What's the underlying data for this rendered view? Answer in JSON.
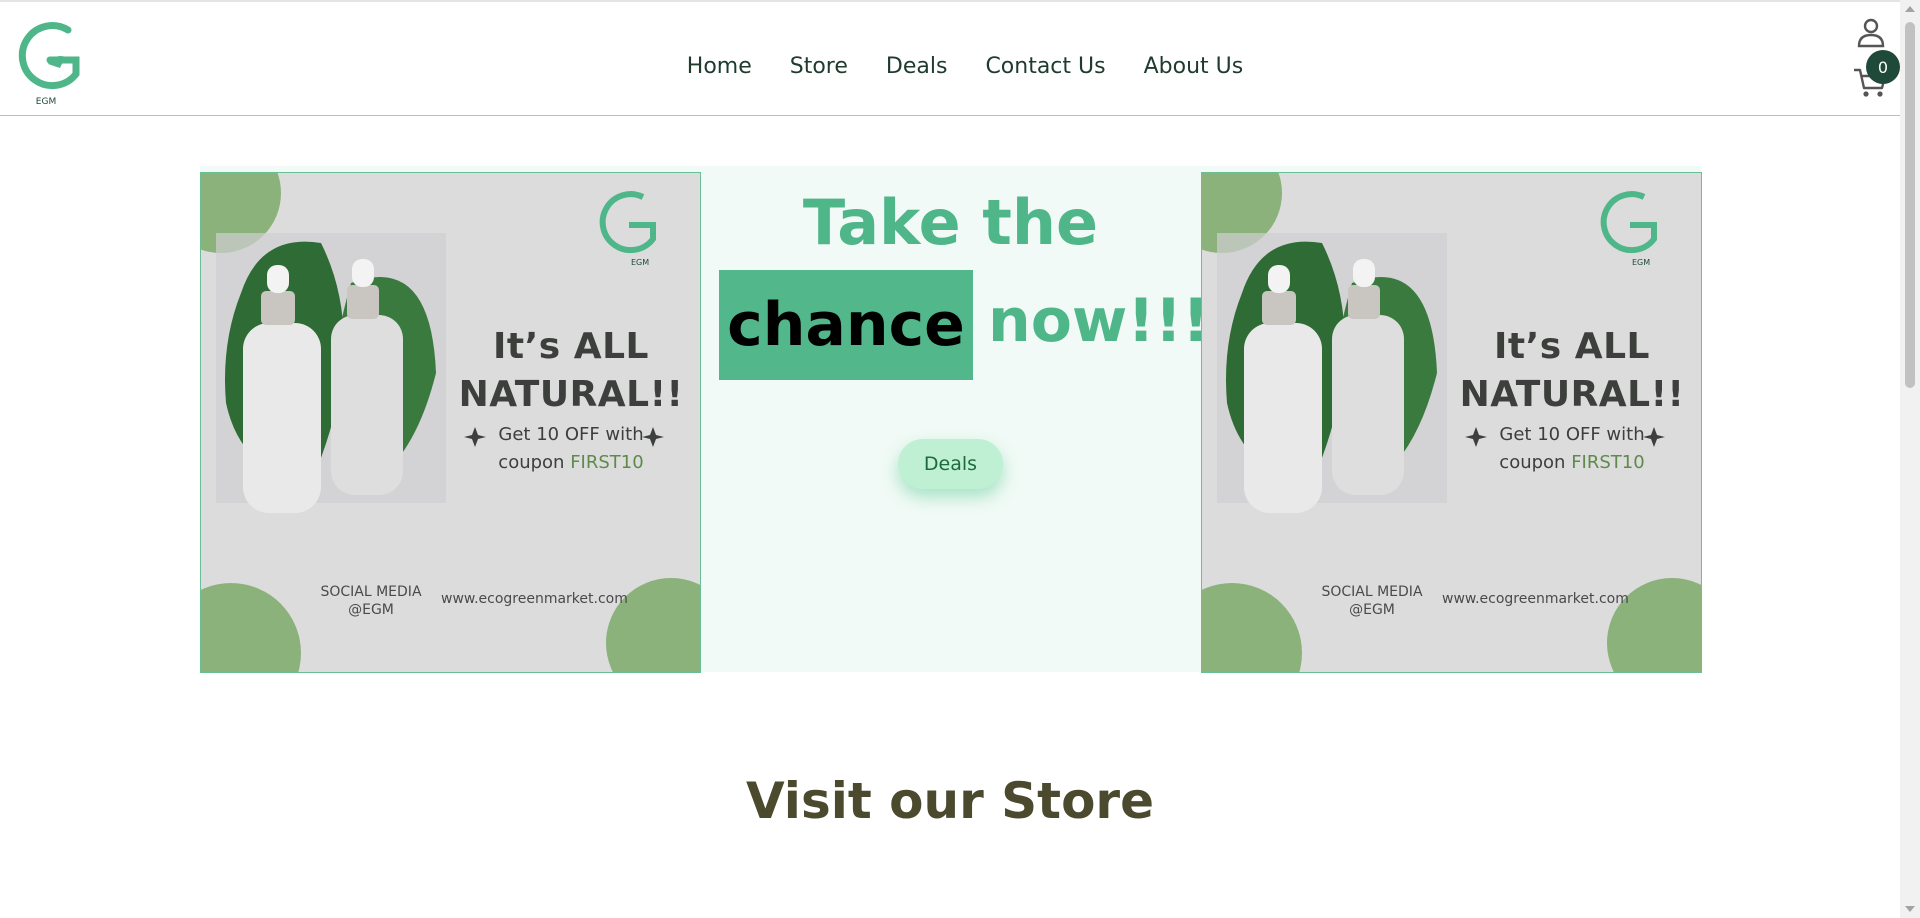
{
  "header": {
    "logo_text": "EGM",
    "nav": [
      "Home",
      "Store",
      "Deals",
      "Contact Us",
      "About Us"
    ],
    "cart_count": "0"
  },
  "hero": {
    "headline_line1": "Take the",
    "headline_highlight": "chance",
    "headline_end": "now!!!",
    "deals_button": "Deals",
    "promo": {
      "logo_text": "EGM",
      "title_line1": "It’s ALL",
      "title_line2": "NATURAL!!",
      "sub_line1": "Get 10 OFF with",
      "sub_line2_prefix": "coupon",
      "coupon_code": "FIRST10",
      "social_line1": "SOCIAL MEDIA",
      "social_line2": "@EGM",
      "website": "www.ecogreenmarket.com"
    }
  },
  "main": {
    "section_title": "Visit our Store"
  },
  "colors": {
    "brand_green": "#4fb68a",
    "dark_green": "#1f4a3a",
    "title_olive": "#4b4a2f"
  },
  "icons": [
    "logo-g-icon",
    "user-icon",
    "cart-icon",
    "leaf-icon",
    "sparkle-icon"
  ]
}
